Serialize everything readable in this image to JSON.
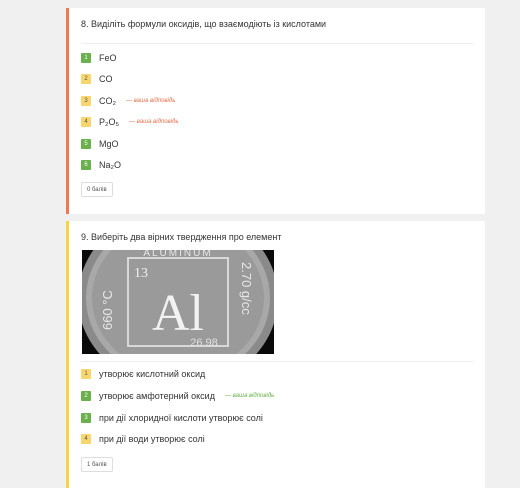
{
  "q8": {
    "title": "8. Виділіть формули оксидів, що взаємодіють із кислотами",
    "options": [
      {
        "num": "1",
        "text": "FeO",
        "status": "green",
        "note": ""
      },
      {
        "num": "2",
        "text": "CO",
        "status": "yellow",
        "note": ""
      },
      {
        "num": "3",
        "text": "CO₂",
        "status": "yellow",
        "note": "— ваша відповідь"
      },
      {
        "num": "4",
        "text": "P₂O₅",
        "status": "yellow",
        "note": "— ваша відповідь"
      },
      {
        "num": "5",
        "text": "MgO",
        "status": "green",
        "note": ""
      },
      {
        "num": "6",
        "text": "Na₂O",
        "status": "green",
        "note": ""
      }
    ],
    "score": "0 балів"
  },
  "q9": {
    "title": "9. Виберіть два вірних твердження про елемент",
    "image": {
      "top_text": "ALUMINUM",
      "number": "13",
      "symbol": "Al",
      "mass": "26.98",
      "left_text": "660 °C",
      "right_text": "2.70 g/cc"
    },
    "options": [
      {
        "num": "1",
        "text": "утворює кислотний оксид",
        "status": "yellow",
        "note": ""
      },
      {
        "num": "2",
        "text": "утворює амфотерний оксид",
        "status": "green",
        "note": "— ваша відповідь"
      },
      {
        "num": "3",
        "text": "при дії хлоридної кислоти утворює солі",
        "status": "green",
        "note": ""
      },
      {
        "num": "4",
        "text": "при дії води утворює солі",
        "status": "yellow",
        "note": ""
      }
    ],
    "score": "1 балів"
  },
  "colors": {
    "correct": "#6ab04c",
    "neutral": "#f8d66d",
    "wrong_accent": "#f07850",
    "partial_accent": "#f5d742"
  }
}
